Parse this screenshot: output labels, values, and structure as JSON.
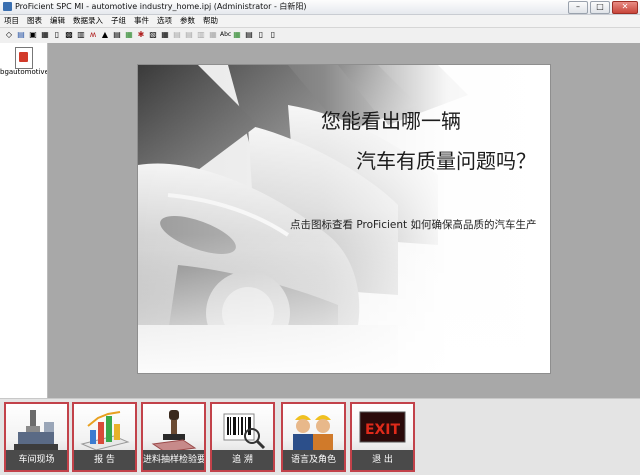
{
  "window": {
    "title": "ProFicient SPC MI - automotive industry_home.ipj (Administrator - 白新阳)",
    "buttons": [
      "–",
      "□",
      "✕"
    ]
  },
  "menu": [
    "项目",
    "图表",
    "编辑",
    "数据录入",
    "子组",
    "事件",
    "选项",
    "参数",
    "帮助"
  ],
  "toolbar": {
    "icons": [
      "new-icon",
      "open-icon",
      "save-icon",
      "print-icon",
      "preview-icon",
      "grid-icon",
      "table-icon",
      "chart-icon",
      "run-chart-icon",
      "alarm-icon",
      "filter-icon",
      "sort-icon",
      "export-icon",
      "settings-icon",
      "dim-1-icon",
      "dim-2-icon",
      "dim-3-icon",
      "dim-4-icon",
      "text-abc-icon",
      "data-icon",
      "layout-icon",
      "window-icon"
    ]
  },
  "left_panel": {
    "file_label": "bgautomotive"
  },
  "banner": {
    "line1": "您能看出哪一辆",
    "line2": "汽车有质量问题吗？",
    "subtitle": "点击图标查看 ProFicient 如何确保高品质的汽车生产"
  },
  "launchers": [
    {
      "name": "shop-floor",
      "label": "车间现场"
    },
    {
      "name": "reports",
      "label": "报  告"
    },
    {
      "name": "inspection",
      "label": "进料抽样检验要求"
    },
    {
      "name": "traceability",
      "label": "追  溯"
    },
    {
      "name": "roles",
      "label": "语言及角色"
    },
    {
      "name": "exit",
      "label": "退  出",
      "sign": "EXIT"
    }
  ]
}
